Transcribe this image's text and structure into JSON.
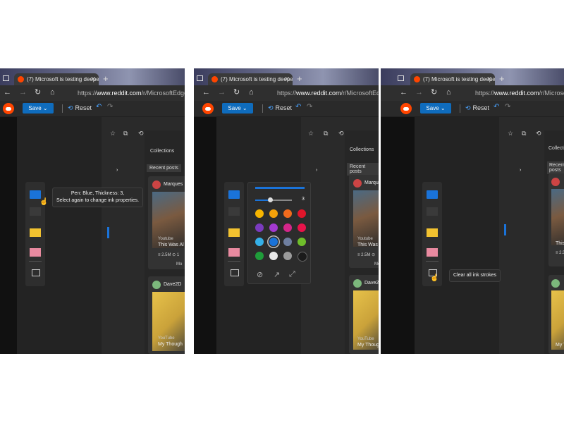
{
  "browser": {
    "tab_title": "(7) Microsoft is testing deeper i",
    "url_prefix": "https://",
    "url_host": "www.reddit.com",
    "url_path": "/r/MicrosoftEdge/comm"
  },
  "ink_toolbar": {
    "save_label": "Save",
    "reset_label": "Reset"
  },
  "edge_pane": {
    "collections_label": "Collections",
    "recent_posts_label": "Recent posts",
    "post1": {
      "author": "Marques",
      "source": "Youtube",
      "title": "This Was Al",
      "views": "2.5M",
      "more": "Mo"
    },
    "post2": {
      "author": "Dave2D",
      "source": "YouTube",
      "title": "My Though"
    }
  },
  "tooltips": {
    "pen_line1": "Pen: Blue, Thickness: 3,",
    "pen_line2": "Select again to change ink properties.",
    "clear_all": "Clear all ink strokes"
  },
  "pen_flyout": {
    "thickness_value": "3",
    "colors": [
      "#f7b500",
      "#f5a20a",
      "#f26b1d",
      "#e0162b",
      "#7b3bbf",
      "#a43ad1",
      "#d4268a",
      "#e8134a",
      "#35b0e8",
      "#1a73d9",
      "#6f7fa0",
      "#6fbe2b",
      "#1f9d3a",
      "#e8e8e8",
      "#9b9b9b",
      "#1b1b1b"
    ],
    "selected_color_index": 9
  }
}
